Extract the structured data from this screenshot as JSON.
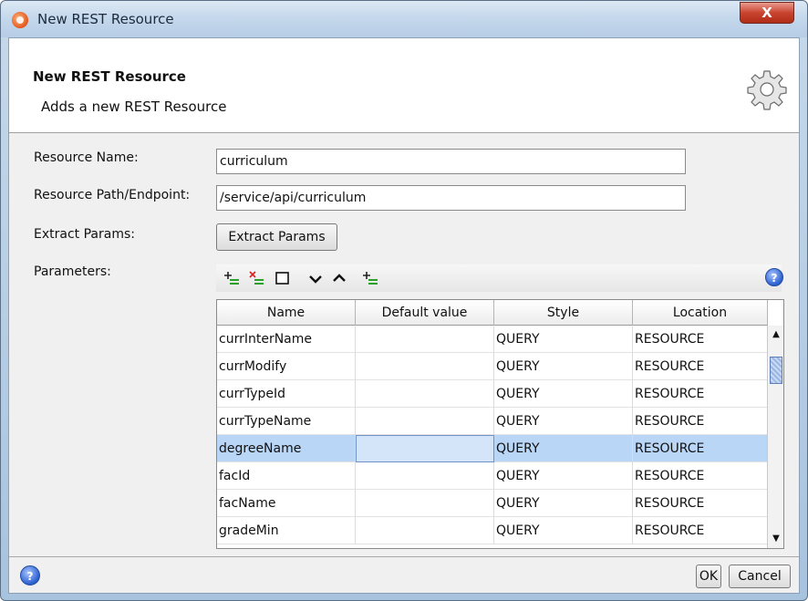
{
  "window": {
    "title": "New REST Resource",
    "close_label": "X"
  },
  "banner": {
    "title": "New REST Resource",
    "subtitle": "Adds a new REST Resource"
  },
  "form": {
    "resource_name_label": "Resource Name:",
    "resource_name_value": "curriculum",
    "resource_path_label": "Resource Path/Endpoint:",
    "resource_path_value": "/service/api/curriculum",
    "extract_params_label": "Extract Params:",
    "extract_params_button": "Extract Params",
    "parameters_label": "Parameters:"
  },
  "toolbar": {
    "icons": [
      "add-param-icon",
      "remove-param-icon",
      "clear-icon",
      "move-down-icon",
      "move-up-icon",
      "insert-param-icon",
      "help-icon"
    ]
  },
  "table": {
    "columns": [
      "Name",
      "Default value",
      "Style",
      "Location"
    ],
    "rows": [
      {
        "name": "currInterName",
        "default": "",
        "style": "QUERY",
        "location": "RESOURCE"
      },
      {
        "name": "currModify",
        "default": "",
        "style": "QUERY",
        "location": "RESOURCE"
      },
      {
        "name": "currTypeId",
        "default": "",
        "style": "QUERY",
        "location": "RESOURCE"
      },
      {
        "name": "currTypeName",
        "default": "",
        "style": "QUERY",
        "location": "RESOURCE"
      },
      {
        "name": "degreeName",
        "default": "",
        "style": "QUERY",
        "location": "RESOURCE"
      },
      {
        "name": "facId",
        "default": "",
        "style": "QUERY",
        "location": "RESOURCE"
      },
      {
        "name": "facName",
        "default": "",
        "style": "QUERY",
        "location": "RESOURCE"
      },
      {
        "name": "gradeMin",
        "default": "",
        "style": "QUERY",
        "location": "RESOURCE"
      }
    ]
  },
  "footer": {
    "ok_label": "OK",
    "cancel_label": "Cancel"
  },
  "colors": {
    "selection": "#b9d6f7",
    "close": "#c9442f",
    "help": "#2b5fcf"
  }
}
